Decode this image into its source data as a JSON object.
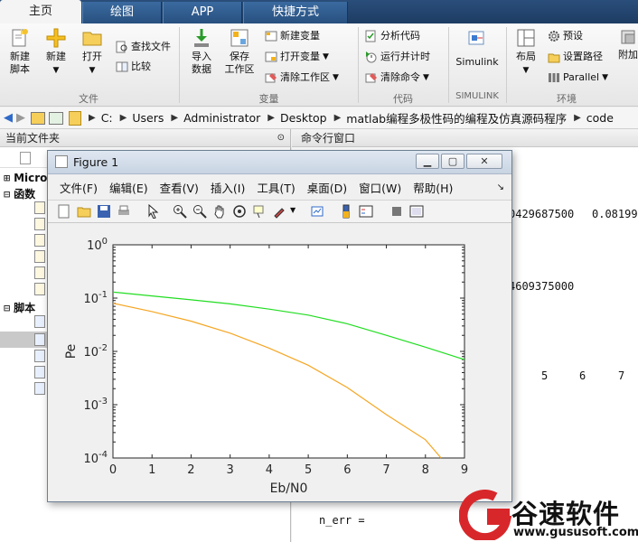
{
  "tabs": [
    {
      "label": "主页",
      "active": true
    },
    {
      "label": "绘图",
      "active": false
    },
    {
      "label": "APP",
      "active": false
    },
    {
      "label": "快捷方式",
      "active": false
    }
  ],
  "ribbon": {
    "new_script": "新建\n脚本",
    "new_script_l1": "新建",
    "new_script_l2": "脚本",
    "new": "新建",
    "open": "打开",
    "find_files": "查找文件",
    "compare": "比较",
    "import_l1": "导入",
    "import_l2": "数据",
    "save_ws_l1": "保存",
    "save_ws_l2": "工作区",
    "new_var": "新建变量",
    "open_var": "打开变量",
    "clear_ws": "清除工作区",
    "analyze_code": "分析代码",
    "run_time": "运行并计时",
    "clear_cmd": "清除命令",
    "simulink": "Simulink",
    "layout": "布局",
    "preferences": "预设",
    "set_path": "设置路径",
    "parallel": "Parallel",
    "addons": "附加",
    "groups": {
      "file": "文件",
      "variable": "变量",
      "code": "代码",
      "simulink": "SIMULINK",
      "env": "环境"
    }
  },
  "address": {
    "crumbs": [
      "C:",
      "Users",
      "Administrator",
      "Desktop",
      "matlab编程多极性码的编程及仿真源码程序",
      "code"
    ]
  },
  "left_panel": {
    "title": "当前文件夹",
    "rows": [
      "Micro",
      "函数",
      "脚本"
    ]
  },
  "command_window": {
    "title": "命令行窗口",
    "line1_a": "0429687500",
    "line1_b": "0.08199",
    "line2": "4609375000",
    "line3": [
      "5",
      "6",
      "7"
    ],
    "line4": "n_err ="
  },
  "figure": {
    "title": "Figure 1",
    "menu": [
      "文件(F)",
      "编辑(E)",
      "查看(V)",
      "插入(I)",
      "工具(T)",
      "桌面(D)",
      "窗口(W)",
      "帮助(H)"
    ]
  },
  "chart_data": {
    "type": "line",
    "xlabel": "Eb/N0",
    "ylabel": "Pe",
    "xlim": [
      0,
      9
    ],
    "ylim": [
      0.0001,
      1
    ],
    "yscale": "log",
    "xticks": [
      "0",
      "1",
      "2",
      "3",
      "4",
      "5",
      "6",
      "7",
      "8",
      "9"
    ],
    "yticks": [
      "10^0",
      "10^-1",
      "10^-2",
      "10^-3",
      "10^-4"
    ],
    "series": [
      {
        "color": "#22dd22",
        "x": [
          0,
          1,
          2,
          3,
          4,
          5,
          6,
          7,
          8,
          9
        ],
        "y": [
          0.13,
          0.11,
          0.093,
          0.078,
          0.062,
          0.048,
          0.033,
          0.02,
          0.012,
          0.007
        ]
      },
      {
        "color": "#f5a623",
        "x": [
          0,
          1,
          2,
          3,
          4,
          5,
          6,
          7,
          8,
          8.4
        ],
        "y": [
          0.08,
          0.056,
          0.037,
          0.022,
          0.0115,
          0.0055,
          0.0021,
          0.00065,
          0.00022,
          0.0001
        ]
      }
    ]
  },
  "watermark": {
    "cn": "谷速软件",
    "url": "www.gususoft.com",
    "color": "#d8272b"
  }
}
